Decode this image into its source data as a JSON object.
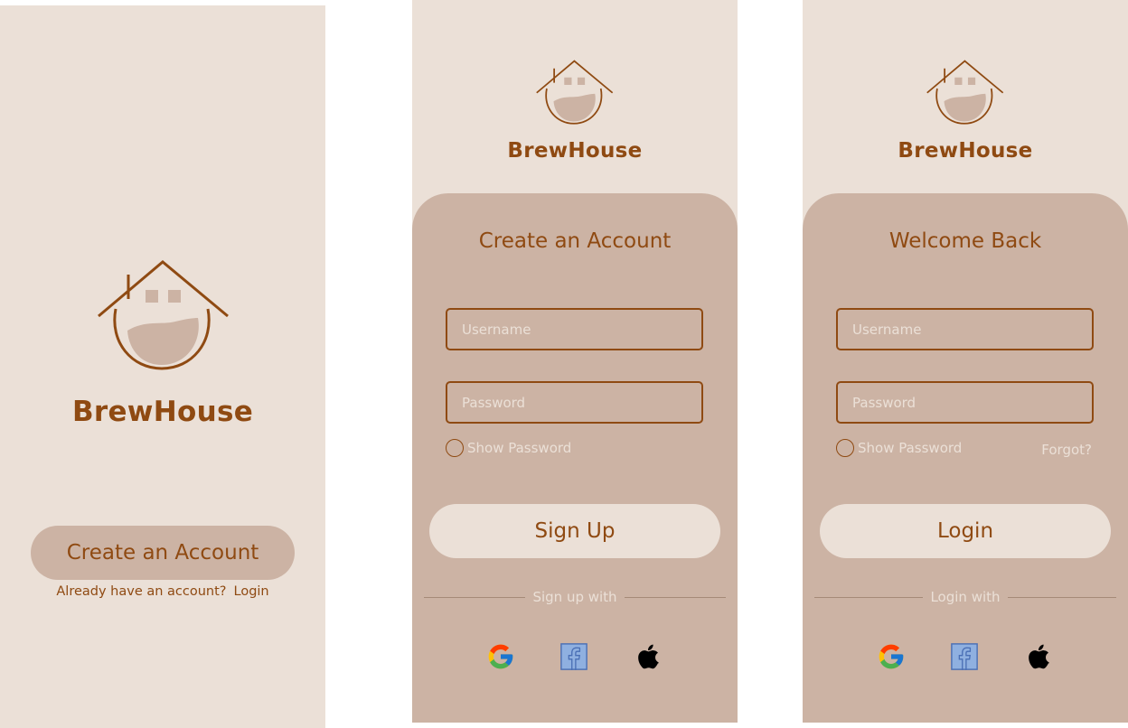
{
  "colors": {
    "accent": "#8f4a12",
    "background": "#ebe0d7",
    "card": "#ccb3a4"
  },
  "brand": {
    "name": "BrewHouse"
  },
  "splash": {
    "cta_label": "Create an Account",
    "already_text": "Already have an account?",
    "login_link": "Login"
  },
  "signup": {
    "title": "Create an Account",
    "username_placeholder": "Username",
    "password_placeholder": "Password",
    "show_password": "Show Password",
    "submit_label": "Sign Up",
    "divider_text": "Sign up with",
    "social": [
      "google-icon",
      "facebook-icon",
      "apple-icon"
    ]
  },
  "login": {
    "title": "Welcome Back",
    "username_placeholder": "Username",
    "password_placeholder": "Password",
    "show_password": "Show Password",
    "forgot": "Forgot?",
    "submit_label": "Login",
    "divider_text": "Login with",
    "social": [
      "google-icon",
      "facebook-icon",
      "apple-icon"
    ]
  }
}
